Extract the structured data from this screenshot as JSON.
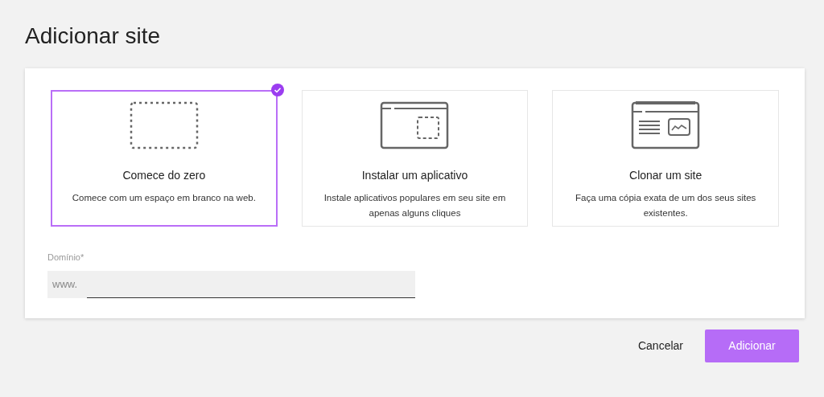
{
  "title": "Adicionar site",
  "options": [
    {
      "kind": "blank",
      "title": "Comece do zero",
      "description": "Comece com um espaço em branco na web.",
      "selected": true
    },
    {
      "kind": "app",
      "title": "Instalar um aplicativo",
      "description": "Instale aplicativos populares em seu site em apenas alguns cliques",
      "selected": false
    },
    {
      "kind": "clone",
      "title": "Clonar um site",
      "description": "Faça uma cópia exata de um dos seus sites existentes.",
      "selected": false
    }
  ],
  "domain": {
    "label": "Domínio*",
    "prefix": "www."
  },
  "buttons": {
    "cancel": "Cancelar",
    "submit": "Adicionar"
  }
}
